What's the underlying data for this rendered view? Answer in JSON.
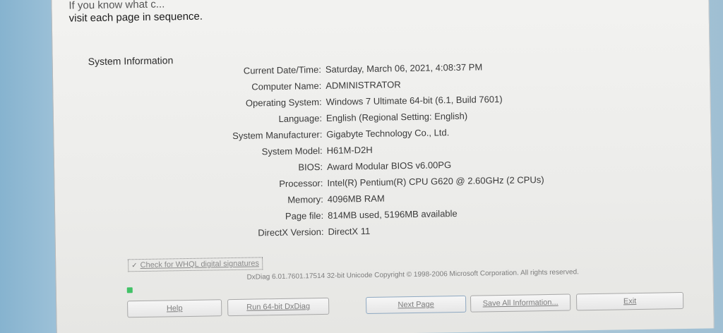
{
  "intro": {
    "line1": "If you know what c...",
    "line2": "visit each page in sequence."
  },
  "system_information": {
    "title": "System Information",
    "rows": [
      {
        "label": "Current Date/Time:",
        "value": "Saturday, March 06, 2021, 4:08:37 PM"
      },
      {
        "label": "Computer Name:",
        "value": "ADMINISTRATOR"
      },
      {
        "label": "Operating System:",
        "value": "Windows 7 Ultimate 64-bit (6.1, Build 7601)"
      },
      {
        "label": "Language:",
        "value": "English (Regional Setting: English)"
      },
      {
        "label": "System Manufacturer:",
        "value": "Gigabyte Technology Co., Ltd."
      },
      {
        "label": "System Model:",
        "value": "H61M-D2H"
      },
      {
        "label": "BIOS:",
        "value": "Award Modular BIOS v6.00PG"
      },
      {
        "label": "Processor:",
        "value": "Intel(R) Pentium(R) CPU G620 @ 2.60GHz (2 CPUs)"
      },
      {
        "label": "Memory:",
        "value": "4096MB RAM"
      },
      {
        "label": "Page file:",
        "value": "814MB used, 5196MB available"
      },
      {
        "label": "DirectX Version:",
        "value": "DirectX 11"
      }
    ]
  },
  "whql_checkbox": {
    "label": "Check for WHQL digital signatures",
    "checked": true
  },
  "copyright": "DxDiag 6.01.7601.17514 32-bit Unicode Copyright © 1998-2006 Microsoft Corporation. All rights reserved.",
  "progress": {
    "color": "#42c267"
  },
  "buttons": {
    "help": "Help",
    "run64": "Run 64-bit DxDiag",
    "next": "Next Page",
    "save": "Save All Information...",
    "exit": "Exit"
  }
}
